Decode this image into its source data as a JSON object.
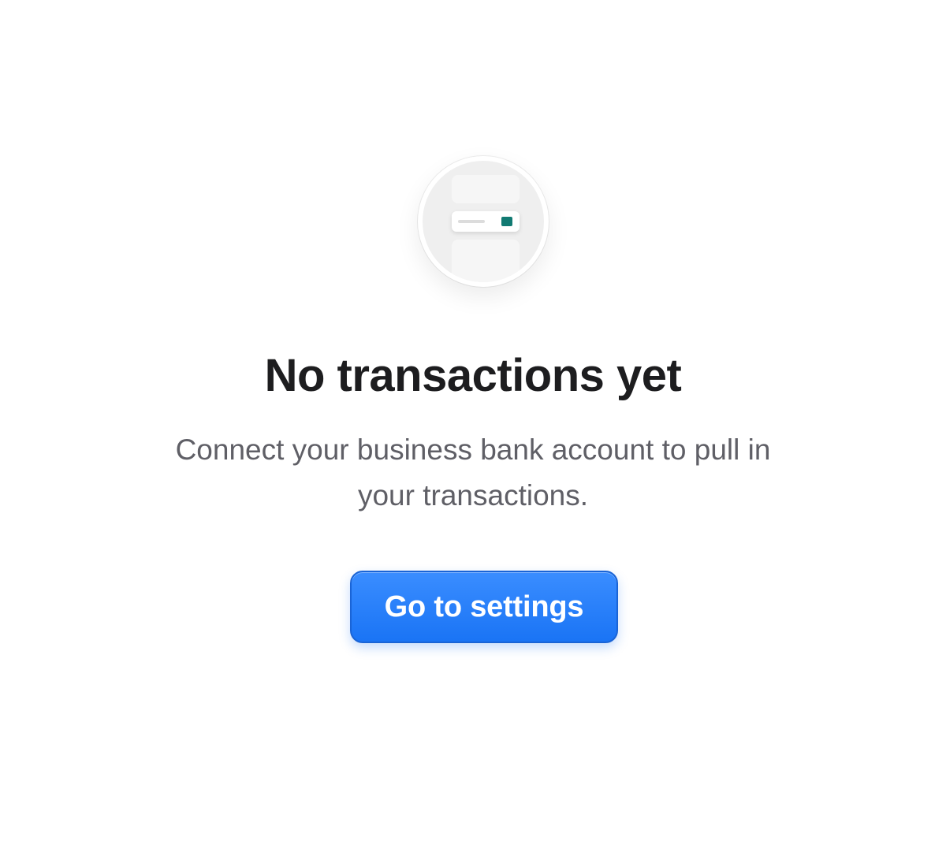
{
  "empty_state": {
    "illustration": "transactions-list-icon",
    "title": "No transactions yet",
    "description": "Connect your business bank account to pull in your transactions.",
    "cta_label": "Go to settings"
  },
  "colors": {
    "accent": "#1a74f5",
    "title_text": "#1d1d1f",
    "body_text": "#5f5f66",
    "chip": "#117a72"
  }
}
